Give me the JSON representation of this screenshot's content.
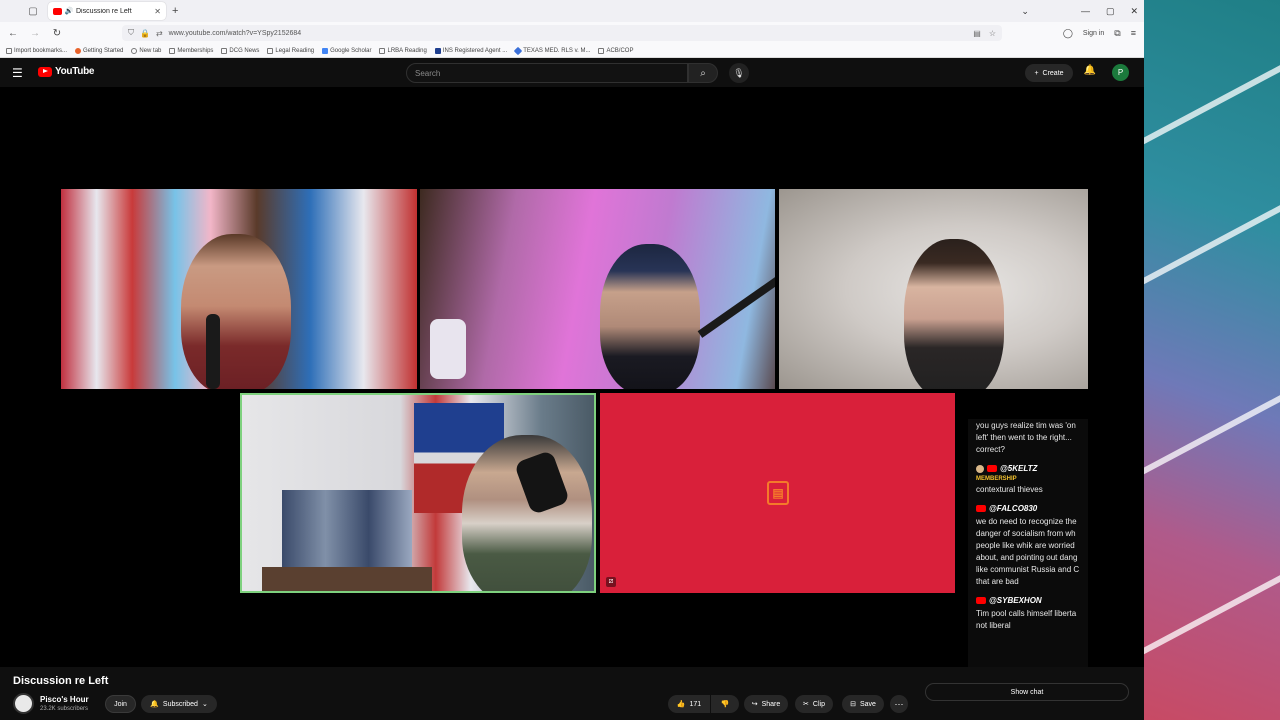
{
  "browser": {
    "tab_title": "Discussion re Left",
    "url": "www.youtube.com/watch?v=YSpy2152684",
    "sign_in": "Sign in",
    "bookmarks": [
      "Import bookmarks...",
      "Getting Started",
      "New tab",
      "Memberships",
      "DCG News",
      "Legal Reading",
      "Google Scholar",
      "LRBA Reading",
      "INS Registered Agent ...",
      "TEXAS MED. RLS v. M...",
      "ACB/COP"
    ]
  },
  "youtube": {
    "logo_text": "YouTube",
    "search_placeholder": "Search",
    "create_label": "Create",
    "avatar_letter": "P"
  },
  "chat": {
    "messages": [
      {
        "author": "",
        "membership": "",
        "text": "you guys realize tim was 'on\nleft' then went to the right...\ncorrect?"
      },
      {
        "author": "@5KELTZ",
        "membership": "MEMBERSHIP",
        "text": "contextural thieves"
      },
      {
        "author": "@FALCO830",
        "membership": "",
        "text": "we do need to recognize the\ndanger of socialism from wh\npeople like whik are worried\nabout, and pointing out dang\nlike communist Russia and C\nthat are bad"
      },
      {
        "author": "@SYBEXHON",
        "membership": "",
        "text": "Tim pool calls himself liberta\nnot liberal"
      }
    ]
  },
  "video": {
    "title": "Discussion re Left",
    "channel_name": "Pisco's Hour",
    "subscribers": "23.2K subscribers",
    "join_label": "Join",
    "subscribed_label": "Subscribed",
    "like_count": "171",
    "share_label": "Share",
    "clip_label": "Clip",
    "save_label": "Save",
    "show_chat_label": "Show chat"
  }
}
